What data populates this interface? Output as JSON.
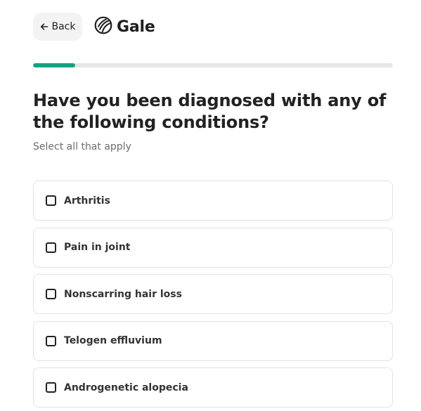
{
  "header": {
    "back_label": "Back",
    "brand_name": "Gale"
  },
  "progress": {
    "fraction": 0.117,
    "fill_color": "#12a37f",
    "track_color": "#e6e6e6"
  },
  "question": {
    "title": "Have you been diagnosed with any of the following conditions?",
    "subtitle": "Select all that apply"
  },
  "options": [
    {
      "label": "Arthritis",
      "checked": false
    },
    {
      "label": "Pain in joint",
      "checked": false
    },
    {
      "label": "Nonscarring hair loss",
      "checked": false
    },
    {
      "label": "Telogen effluvium",
      "checked": false
    },
    {
      "label": "Androgenetic alopecia",
      "checked": false
    }
  ],
  "icons": {
    "back": "arrow-left-icon",
    "logo": "gale-logo-icon"
  }
}
